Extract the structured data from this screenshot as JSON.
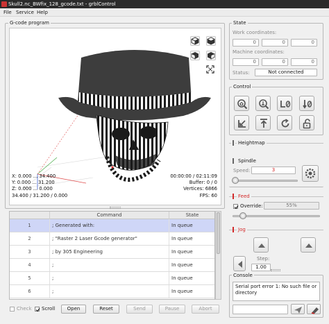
{
  "window": {
    "title": "Skull2.nc_BWfix_128_gcode.txt - grblControl"
  },
  "menu": [
    "File",
    "Service",
    "Help"
  ],
  "gcode_program": {
    "title": "G-code program",
    "coords": {
      "x": "X: 0.000 ... 34.400",
      "y": "Y: 0.000 ... 31.200",
      "z": "Z: 0.000 ... 0.000",
      "size": "34.400 / 31.200 / 0.000"
    },
    "stats": {
      "time": "00:00:00 / 02:11:09",
      "buffer": "Buffer: 0 / 0",
      "vertices": "Vertices: 6866",
      "fps": "FPS: 60"
    },
    "view_buttons": [
      "iso-view-icon",
      "top-view-icon",
      "front-view-icon",
      "left-view-icon",
      "fit-view-icon"
    ]
  },
  "table": {
    "headers": [
      "",
      "Command",
      "State"
    ],
    "rows": [
      {
        "num": "1",
        "command": "; Generated with:",
        "state": "In queue"
      },
      {
        "num": "2",
        "command": "; \"Raster 2 Laser Gcode generator\"",
        "state": "In queue"
      },
      {
        "num": "3",
        "command": "; by 305 Engineering",
        "state": "In queue"
      },
      {
        "num": "4",
        "command": ";",
        "state": "In queue"
      },
      {
        "num": "5",
        "command": ";",
        "state": "In queue"
      },
      {
        "num": "6",
        "command": ";",
        "state": "In queue"
      }
    ]
  },
  "bottom_bar": {
    "check_label": "Check",
    "scroll_label": "Scroll",
    "check_checked": false,
    "scroll_checked": true,
    "open": "Open",
    "reset": "Reset",
    "send": "Send",
    "pause": "Pause",
    "abort": "Abort"
  },
  "state": {
    "title": "State",
    "work_label": "Work coordinates:",
    "work_values": [
      "0",
      "0",
      "0"
    ],
    "machine_label": "Machine coordinates:",
    "machine_values": [
      "0",
      "0",
      "0"
    ],
    "status_label": "Status:",
    "status_value": "Not connected"
  },
  "control": {
    "title": "Control",
    "buttons": [
      "home-icon",
      "zero-probe-icon",
      "zero-xy-icon",
      "zero-z-icon",
      "restore-origin-icon",
      "safe-position-icon",
      "reset-icon",
      "unlock-icon"
    ]
  },
  "heightmap": {
    "title": "Heightmap"
  },
  "spindle": {
    "title": "Spindle",
    "speed_label": "Speed:",
    "speed_value": "3",
    "slider_fraction": 0.02
  },
  "feed": {
    "title": "Feed",
    "override_label": "Override:",
    "override_value": "55%",
    "override_checked": true,
    "slider_fraction": 0.1
  },
  "jog": {
    "title": "Jog",
    "step_label": "Step:",
    "step_value": "1.00"
  },
  "console": {
    "title": "Console",
    "text": "Serial port error 1: No such file or directory"
  },
  "colors": {
    "accent_red": "#d42a2a",
    "selection": "#cfd6f7",
    "status_bg": "#ffffff"
  }
}
